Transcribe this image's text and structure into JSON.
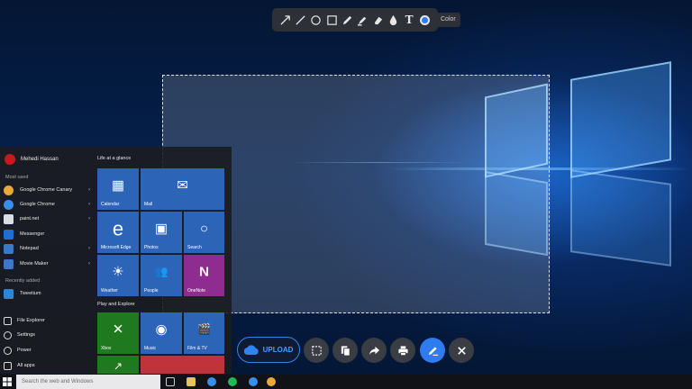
{
  "toolbar_top": {
    "tools": [
      {
        "icon": "arrow-icon"
      },
      {
        "icon": "line-icon"
      },
      {
        "icon": "ellipse-icon"
      },
      {
        "icon": "rectangle-icon"
      },
      {
        "icon": "pencil-icon"
      },
      {
        "icon": "highlighter-icon"
      },
      {
        "icon": "eraser-icon"
      },
      {
        "icon": "blur-drop-icon"
      },
      {
        "icon": "text-icon",
        "glyph": "T"
      },
      {
        "icon": "color-picker-icon"
      }
    ],
    "color_tooltip": "Color",
    "active_color": "#2f7bf0"
  },
  "start_menu": {
    "user_name": "Mehedi Hassan",
    "most_used_label": "Most used",
    "most_used": [
      {
        "label": "Google Chrome Canary",
        "color": "#e9a93a"
      },
      {
        "label": "Google Chrome",
        "color": "#3b8ee8"
      },
      {
        "label": "paint.net",
        "color": "#d8dde6"
      },
      {
        "label": "Messenger",
        "color": "#1f6fd6"
      },
      {
        "label": "Notepad",
        "color": "#3b78c8"
      },
      {
        "label": "Movie Maker",
        "color": "#3b78c8"
      }
    ],
    "recently_added_label": "Recently added",
    "recently_added": [
      {
        "label": "Tweetium",
        "color": "#2a86d6"
      }
    ],
    "system": [
      {
        "label": "File Explorer"
      },
      {
        "label": "Settings"
      },
      {
        "label": "Power"
      },
      {
        "label": "All apps"
      }
    ],
    "group_life": "Life at a glance",
    "group_play": "Play and Explore",
    "tiles": [
      {
        "label": "Calendar",
        "glyph": "▦"
      },
      {
        "label": "Mail",
        "glyph": "✉"
      },
      {
        "label": "Microsoft Edge",
        "glyph": "e"
      },
      {
        "label": "Photos",
        "glyph": "▣"
      },
      {
        "label": "Search",
        "glyph": "○"
      },
      {
        "label": "Weather",
        "glyph": "☀"
      },
      {
        "label": "People",
        "glyph": "👥"
      },
      {
        "label": "OneNote",
        "glyph": "N"
      },
      {
        "label": "Xbox",
        "glyph": "✕"
      },
      {
        "label": "Music",
        "glyph": "◉"
      },
      {
        "label": "Film & TV",
        "glyph": "🎬"
      },
      {
        "label": "",
        "glyph": "↗"
      },
      {
        "label": "",
        "glyph": ""
      }
    ]
  },
  "bottom_toolbar": {
    "upload_label": "UPLOAD",
    "buttons": [
      {
        "name": "select-region-button",
        "icon": "dashed-select-icon"
      },
      {
        "name": "copy-button",
        "icon": "copy-icon"
      },
      {
        "name": "share-button",
        "icon": "share-arrow-icon"
      },
      {
        "name": "print-button",
        "icon": "printer-icon"
      },
      {
        "name": "edit-button",
        "icon": "pen-icon"
      },
      {
        "name": "close-button",
        "icon": "close-icon"
      }
    ]
  },
  "taskbar": {
    "search_placeholder": "Search the web and Windows"
  }
}
